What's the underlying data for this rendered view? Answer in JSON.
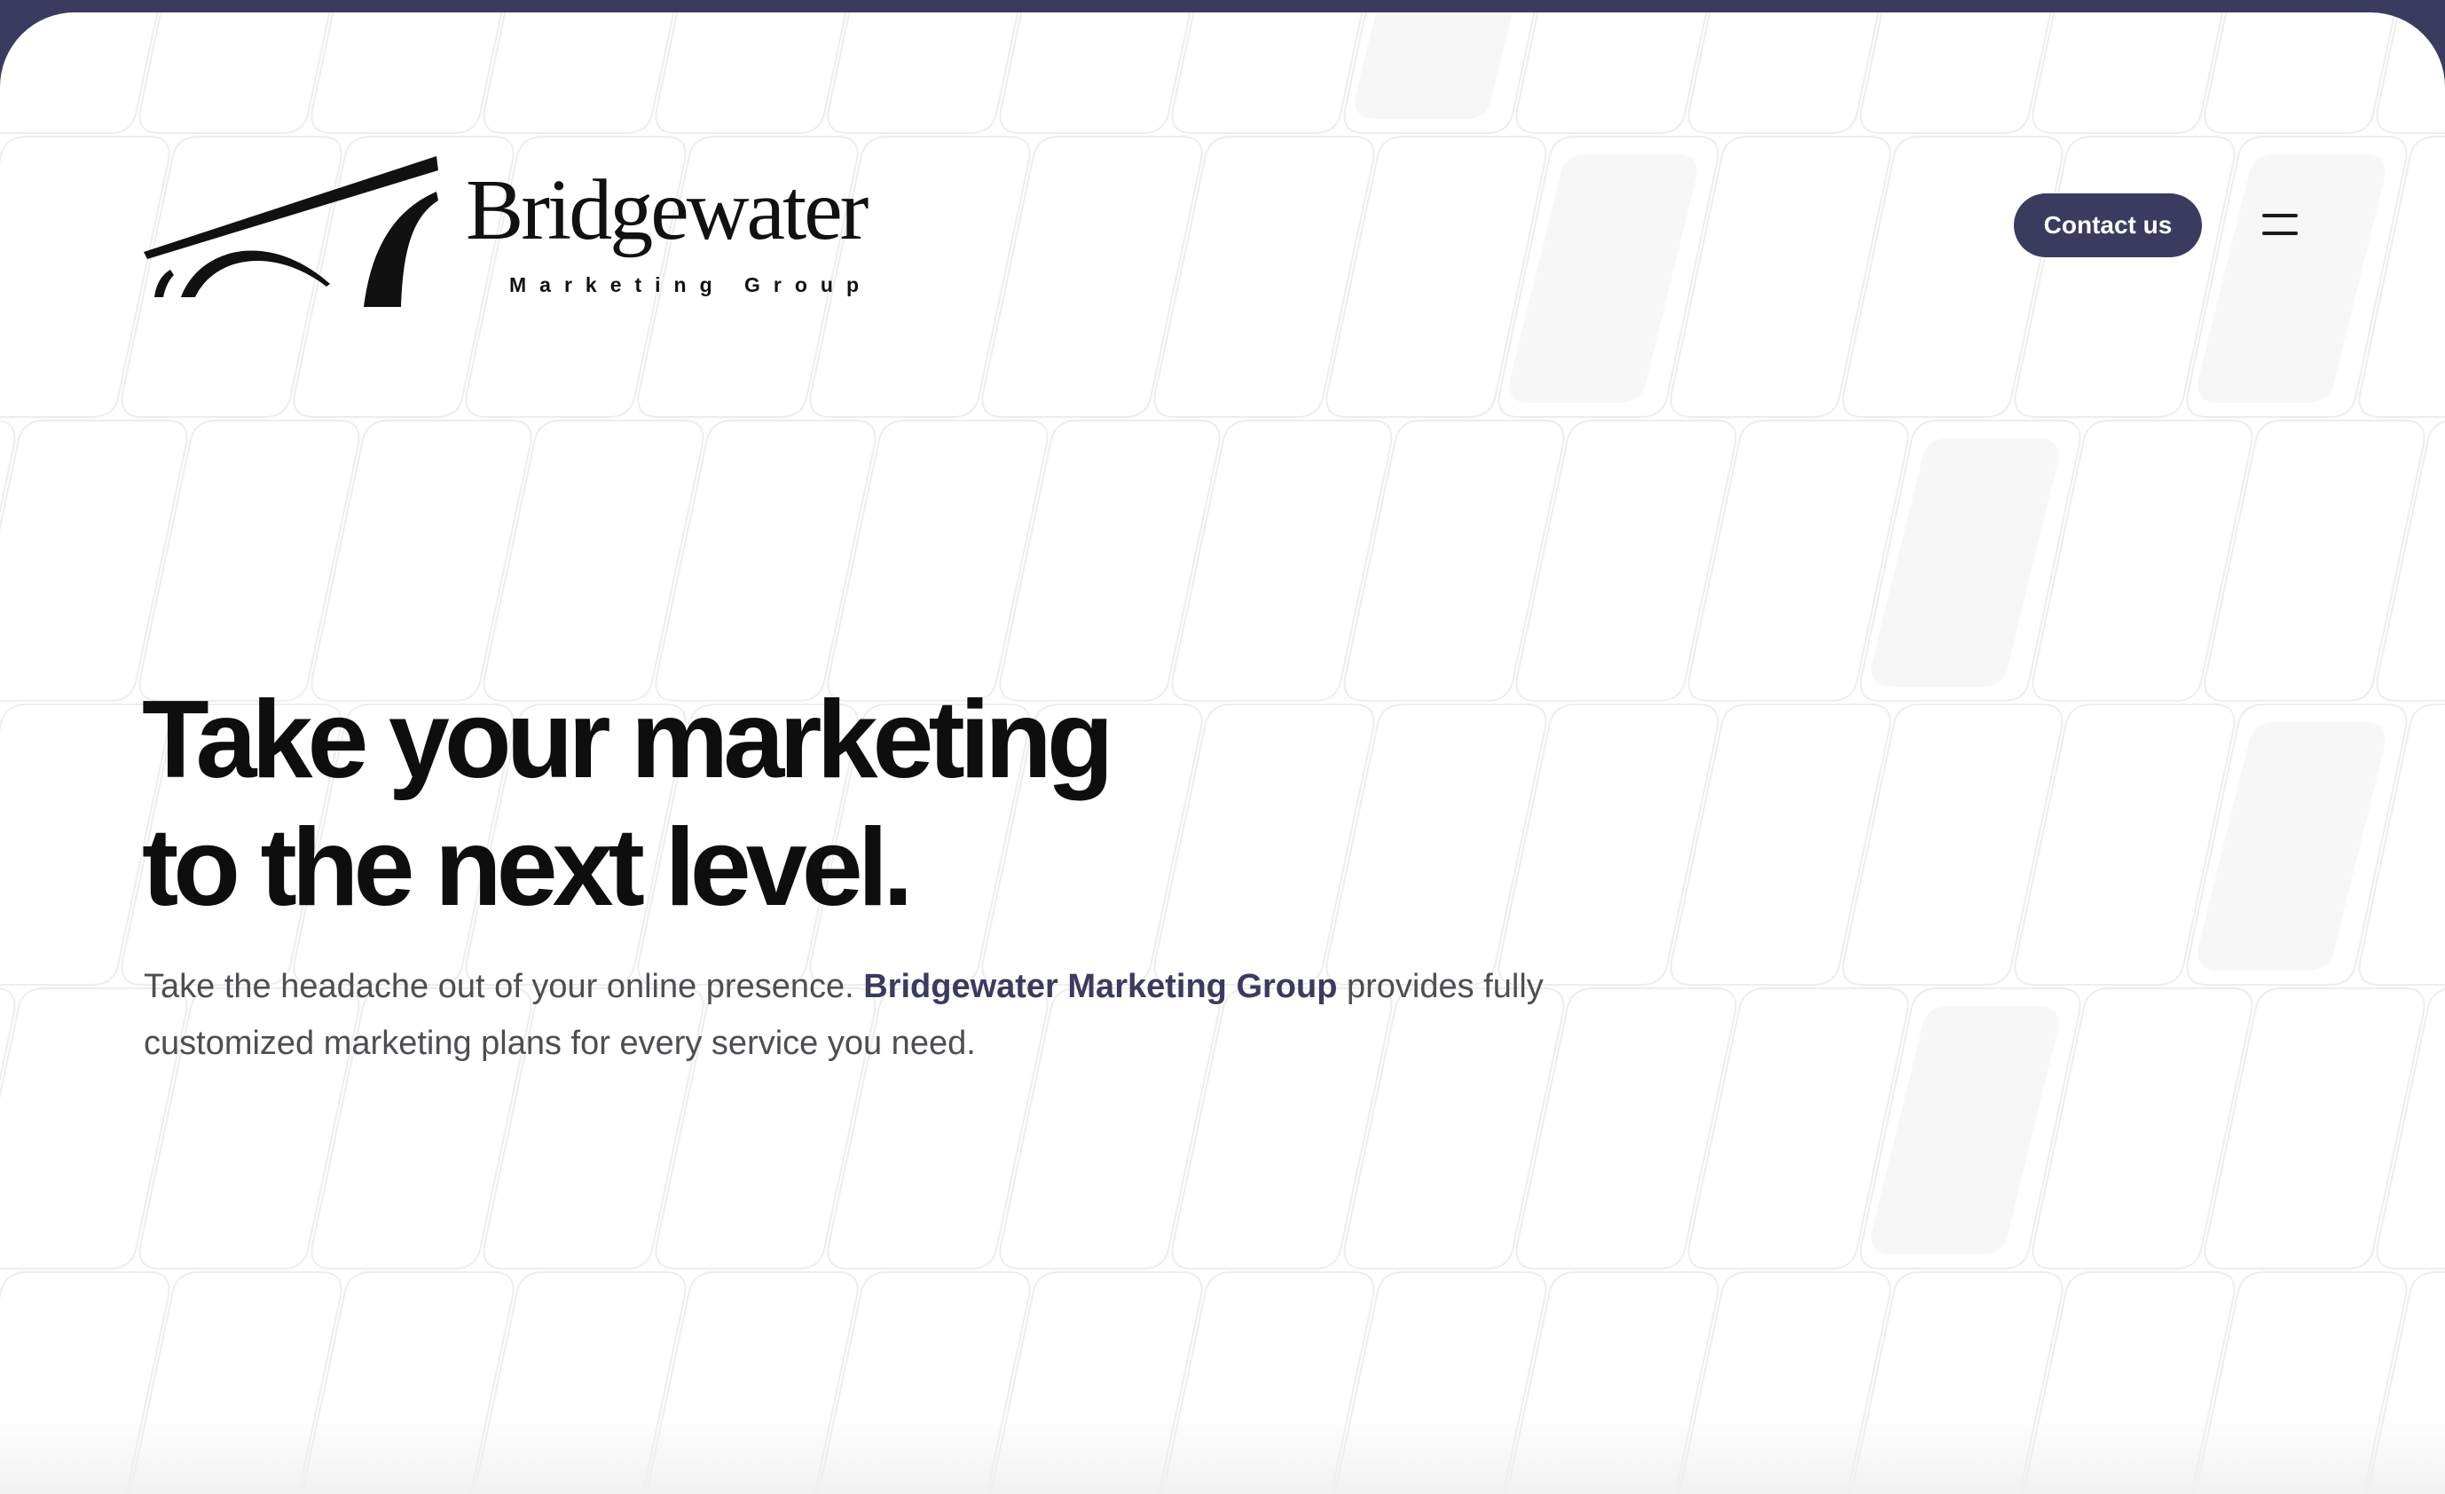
{
  "header": {
    "logo": {
      "wordmark": "Bridgewater",
      "tagline": "Marketing Group"
    },
    "contact_label": "Contact us",
    "menu_icon": "hamburger-menu-icon"
  },
  "hero": {
    "title_line1": "Take your marketing",
    "title_line2": "to the next level.",
    "copy_before": "Take the headache out of your online presence. ",
    "copy_brand": "Bridgewater Marketing Group",
    "copy_after": " provides fully customized marketing plans for every service you need."
  },
  "colors": {
    "frame": "#3a3b5e",
    "accent": "#3a3b5e",
    "heading": "#0e0e0e",
    "body_text": "#4d4d52",
    "background": "#ffffff"
  }
}
